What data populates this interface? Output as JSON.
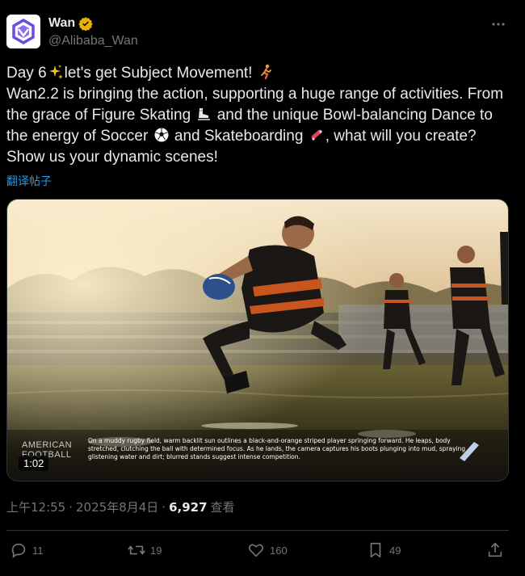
{
  "author": {
    "display_name": "Wan",
    "handle": "@Alibaba_Wan",
    "verified_icon": "verified-badge-icon",
    "avatar_icon": "wan-logo"
  },
  "post": {
    "line1_a": "Day 6",
    "line1_b": "let's get Subject Movement!",
    "line2": "Wan2.2 is bringing the action, supporting a huge range of activities. From",
    "line3_a": "the grace of Figure Skating",
    "line3_b": "and the unique Bowl-balancing Dance to",
    "line4_a": "the energy of Soccer",
    "line4_b": "and Skateboarding",
    "line4_c": ", what will you create?",
    "line5": "Show us your dynamic scenes!"
  },
  "translate_label": "翻译帖子",
  "media": {
    "duration": "1:02",
    "watermark": "AMERICAN FOOTBALL",
    "caption": "On a muddy rugby field, warm backlit sun outlines a black-and-orange striped player springing forward. He leaps, body stretched, clutching the ball with determined focus. As he lands, the camera captures his boots plunging into mud, spraying glistening water and dirt; blurred stands suggest intense competition."
  },
  "meta": {
    "time": "上午12:55",
    "sep1": "·",
    "date": "2025年8月4日",
    "sep2": "·",
    "views_count": "6,927",
    "views_label": "查看"
  },
  "actions": {
    "replies": "11",
    "reposts": "19",
    "likes": "160",
    "bookmarks": "49"
  },
  "colors": {
    "background": "#000000",
    "text": "#e7e9ea",
    "muted": "#71767b",
    "link": "#1d9bf0",
    "verified": "#e7b10a"
  }
}
